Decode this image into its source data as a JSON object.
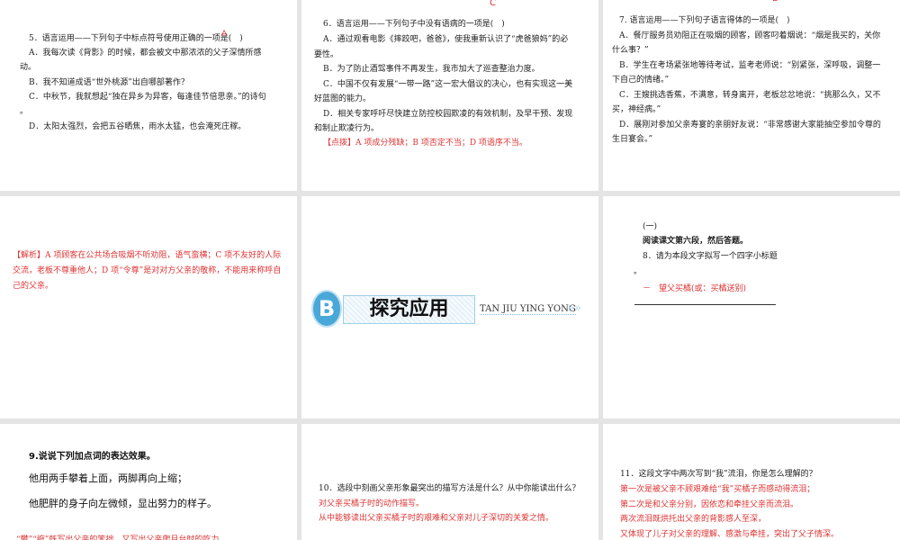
{
  "slides": [
    {
      "question": "5．语言运用——下列句子中标点符号使用正确的一项是(　)",
      "answer_mark": "A",
      "options": [
        "A．我每次读《背影》的时候，都会被文中那浓浓的父子深情所感",
        "动。",
        "B．我不知道成语“世外桃源”出自哪部著作？",
        "C．中秋节，我就想起“独在异乡为异客，每逢佳节倍思亲。”的诗句",
        "。",
        "D．太阳太强烈，会把五谷晒焦，雨水太猛，也会淹死庄稼。"
      ]
    },
    {
      "answer_mark": "C",
      "question": "6．语言运用——下列句子中没有语病的一项是(　)",
      "options": [
        "A．通过观看电影《摔跤吧，爸爸》，使我重新认识了“虎爸狼妈”的必",
        "要性。",
        "B．为了防止酒驾事件不再发生，我市加大了巡查整治力度。",
        "C．中国不仅有发展“一带一路”这一宏大倡议的决心，也有实现这一美",
        "好蓝图的能力。",
        "D．相关专家呼吁尽快建立防控校园欺凌的有效机制，及早干预、发现",
        "和制止欺凌行为。"
      ],
      "hint": "【点拨】A 项成分残缺；B 项否定不当；D 项语序不当。"
    },
    {
      "answer_mark": "B",
      "question": "7. 语言运用——下列句子语言得体的一项是(　)",
      "options": [
        "A．餐厅服务员劝阻正在吸烟的顾客，顾客叼着烟说：“烟是我买的，关你",
        "什么事？”",
        "B．学生在考场紧张地等待考试，监考老师说：“别紧张，深呼吸，调整一",
        "下自己的情绪。”",
        "C．王嫂挑选香蕉，不满意，转身离开，老板忿忿地说：“挑那么久，又不",
        "买，神经病。”",
        "D．展刚对参加父亲寿宴的亲朋好友说：“非常感谢大家能抽空参加令尊的",
        "生日宴会。”"
      ]
    },
    {
      "analysis": [
        "【解析】A 项顾客在公共场合吸烟不听劝阻，语气蛮横；C 项不友好的人际",
        "交流，老板不尊重他人；D 项“令尊”是对对方父亲的敬称，不能用来称呼自",
        "己的父亲。"
      ]
    },
    {
      "badge_letter": "B",
      "title": "探究应用",
      "pinyin": "TAN JIU YING YONG"
    },
    {
      "section": "(一)",
      "instruction": "阅读课文第六段，然后答题。",
      "question": "8．请为本段文字拟写一个四字小标题",
      "period": "。",
      "answer": "－　望父买橘(或：买橘送别)"
    },
    {
      "question": "9.说说下列加点词的表达效果。",
      "lines": [
        "他用两手攀着上面，两脚再向上缩；",
        "他肥胖的身子向左微倾，显出努力的样子。"
      ],
      "analysis": "“攀”“缩”既写出父亲的笨拙，又写出父亲爬月台时的吃力"
    },
    {
      "question": "10．选段中刻画父亲形象最突出的描写方法是什么？从中你能读出什么？",
      "answers": [
        "对父亲买橘子时的动作描写。",
        "从中能够读出父亲买橘子时的艰难和父亲对儿子深切的关爱之情。"
      ]
    },
    {
      "question": "11．这段文字中两次写到“我”流泪，你是怎么理解的？",
      "answers": [
        "第一次是被父亲不顾艰难给“我”买橘子而感动得流泪；",
        "第二次是和父亲分别，因依恋和牵挂父亲而流泪。",
        "两次流泪既烘托出父亲的背影感人至深，",
        "又体现了儿子对父亲的理解、感激与牵挂，突出了父子情深。"
      ]
    }
  ],
  "colors": {
    "answer": "#dd3333",
    "badge": "#4aa8d8"
  }
}
